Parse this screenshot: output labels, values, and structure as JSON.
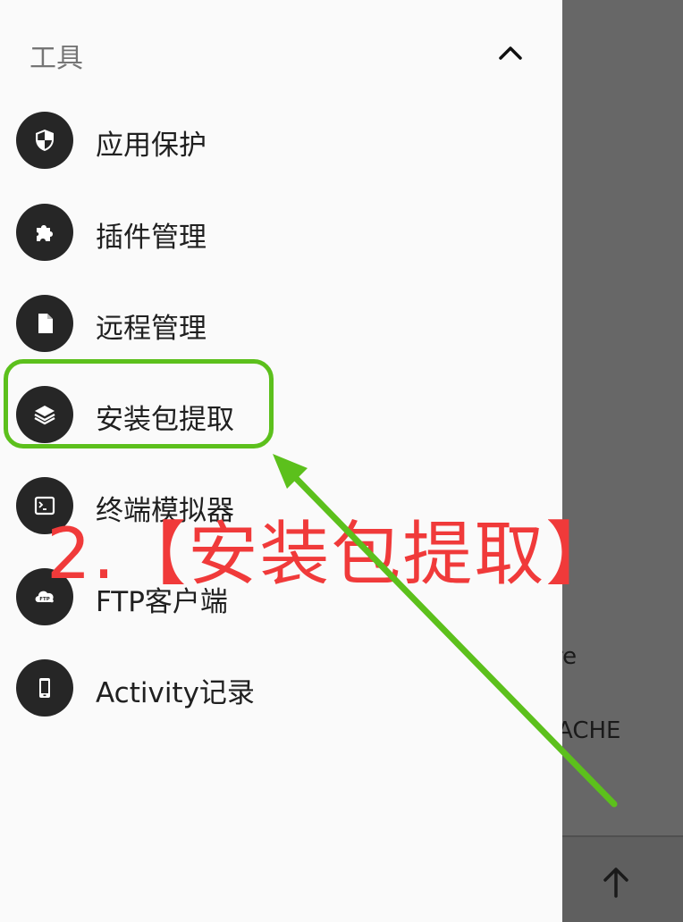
{
  "drawer": {
    "section_title": "工具",
    "collapse_icon": "chevron-up-icon",
    "items": [
      {
        "label": "应用保护",
        "icon": "shield-icon"
      },
      {
        "label": "插件管理",
        "icon": "puzzle-icon"
      },
      {
        "label": "远程管理",
        "icon": "file-icon"
      },
      {
        "label": "安装包提取",
        "icon": "layers-icon"
      },
      {
        "label": "终端模拟器",
        "icon": "terminal-icon"
      },
      {
        "label": "FTP客户端",
        "icon": "ftp-cloud-icon"
      },
      {
        "label": "Activity记录",
        "icon": "phone-icon"
      }
    ]
  },
  "background_app": {
    "text_1": "re",
    "text_2": "ACHE",
    "bottom_icon": "arrow-up-icon"
  },
  "annotation": {
    "text": "2.【安装包提取】",
    "color": "#f03a3a",
    "highlight_color": "#5cc01c"
  }
}
